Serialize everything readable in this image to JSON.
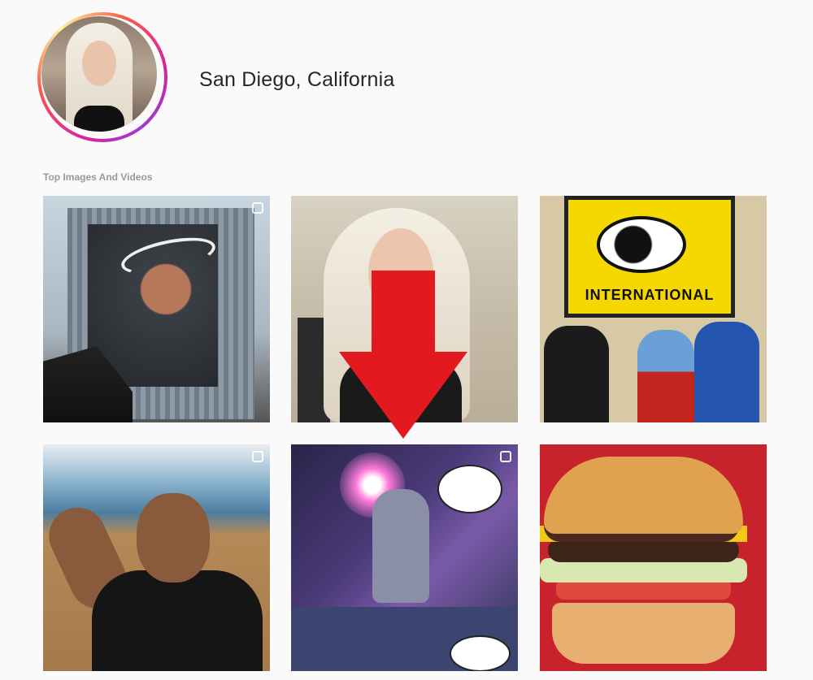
{
  "profile": {
    "location": "San Diego, California"
  },
  "section": {
    "title": "Top Images And Videos"
  },
  "tiles": [
    {
      "id": "t1",
      "type": "carousel"
    },
    {
      "id": "t2",
      "type": "image"
    },
    {
      "id": "t3",
      "type": "image"
    },
    {
      "id": "t4",
      "type": "carousel"
    },
    {
      "id": "t5",
      "type": "carousel"
    },
    {
      "id": "t6",
      "type": "image"
    }
  ],
  "tile3": {
    "sign_text": "INTERNATIONAL"
  },
  "colors": {
    "arrow": "#e3191f",
    "background": "#fafafa"
  }
}
